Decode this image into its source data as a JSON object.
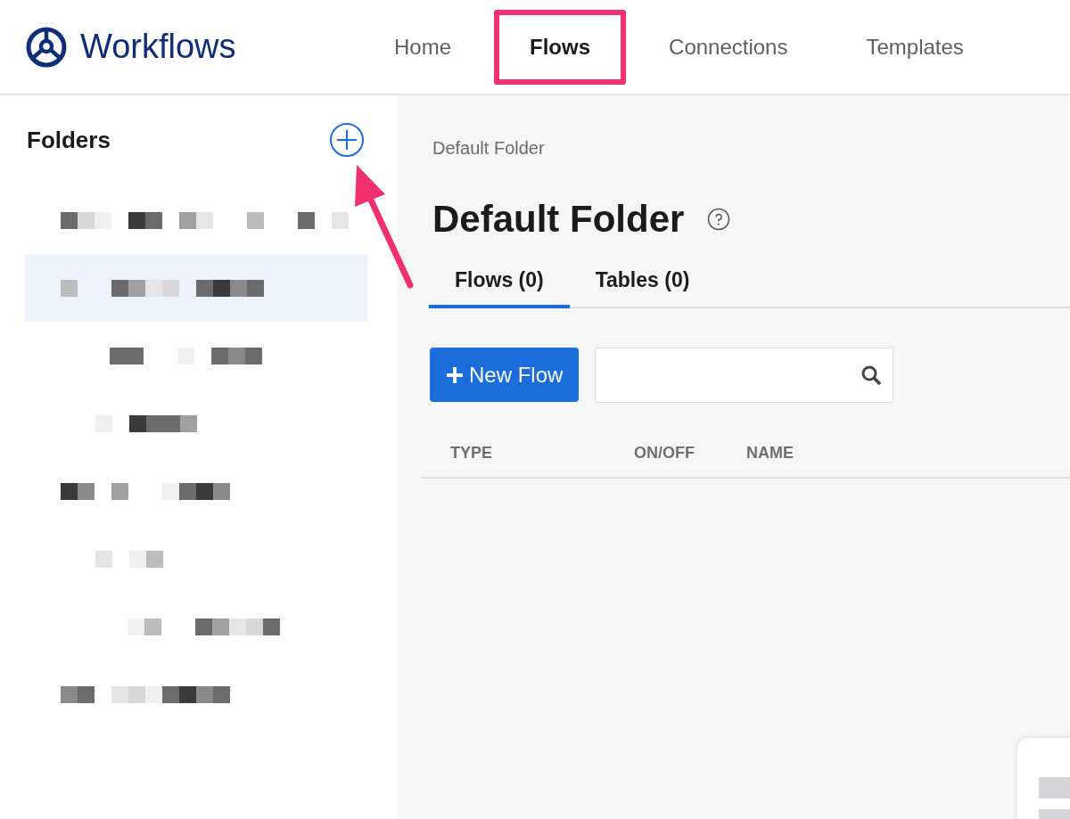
{
  "app": {
    "name": "Workflows"
  },
  "nav": [
    {
      "label": "Home",
      "selected": false
    },
    {
      "label": "Flows",
      "selected": true
    },
    {
      "label": "Connections",
      "selected": false
    },
    {
      "label": "Templates",
      "selected": false
    }
  ],
  "sidebar": {
    "title": "Folders",
    "items": [
      {
        "selected": false
      },
      {
        "selected": true
      },
      {
        "selected": false
      },
      {
        "selected": false
      },
      {
        "selected": false
      },
      {
        "selected": false
      },
      {
        "selected": false
      },
      {
        "selected": false
      }
    ]
  },
  "breadcrumb": "Default Folder",
  "title": "Default Folder",
  "tabs": [
    {
      "label": "Flows (0)",
      "selected": true
    },
    {
      "label": "Tables (0)",
      "selected": false
    }
  ],
  "new_button": "New Flow",
  "table": {
    "columns": [
      "TYPE",
      "ON/OFF",
      "NAME"
    ]
  }
}
